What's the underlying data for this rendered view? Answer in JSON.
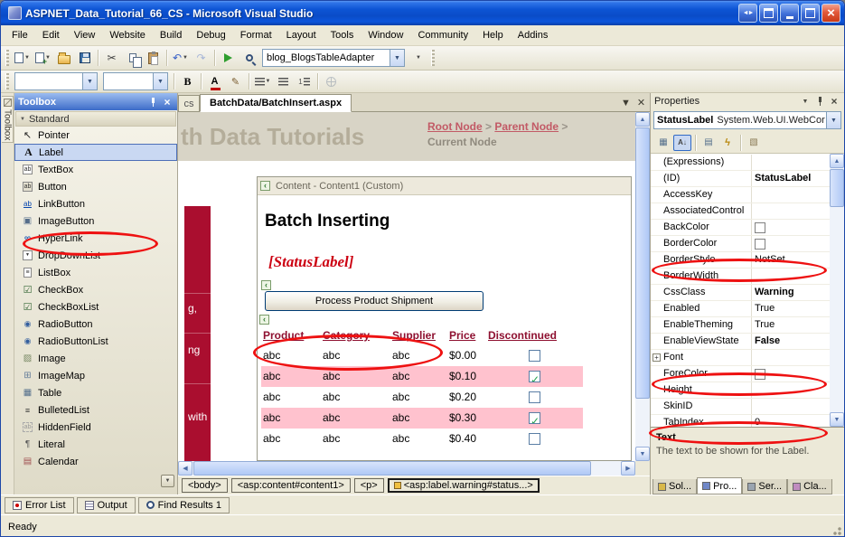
{
  "window": {
    "title": "ASPNET_Data_Tutorial_66_CS - Microsoft Visual Studio",
    "status": "Ready"
  },
  "menubar": {
    "items": [
      "File",
      "Edit",
      "View",
      "Website",
      "Build",
      "Debug",
      "Format",
      "Layout",
      "Tools",
      "Window",
      "Community",
      "Help",
      "Addins"
    ]
  },
  "toolbar": {
    "adapter_combo": "blog_BlogsTableAdapter"
  },
  "toolbox": {
    "side_tab": "Toolbox",
    "title": "Toolbox",
    "group": "Standard",
    "items": [
      {
        "label": "Pointer",
        "icon": "pointer-icon",
        "glyph": "↖"
      },
      {
        "label": "Label",
        "icon": "label-icon",
        "glyph": "A"
      },
      {
        "label": "TextBox",
        "icon": "textbox-icon",
        "glyph": "ab"
      },
      {
        "label": "Button",
        "icon": "button-icon",
        "glyph": "ab"
      },
      {
        "label": "LinkButton",
        "icon": "linkbutton-icon",
        "glyph": "ab"
      },
      {
        "label": "ImageButton",
        "icon": "imagebutton-icon",
        "glyph": "▣"
      },
      {
        "label": "HyperLink",
        "icon": "hyperlink-icon",
        "glyph": "∞"
      },
      {
        "label": "DropDownList",
        "icon": "dropdownlist-icon",
        "glyph": "▼"
      },
      {
        "label": "ListBox",
        "icon": "listbox-icon",
        "glyph": "≡"
      },
      {
        "label": "CheckBox",
        "icon": "checkbox-icon",
        "glyph": "☑"
      },
      {
        "label": "CheckBoxList",
        "icon": "checkboxlist-icon",
        "glyph": "☑"
      },
      {
        "label": "RadioButton",
        "icon": "radiobutton-icon",
        "glyph": "◉"
      },
      {
        "label": "RadioButtonList",
        "icon": "radiobuttonlist-icon",
        "glyph": "◉"
      },
      {
        "label": "Image",
        "icon": "image-icon",
        "glyph": "▨"
      },
      {
        "label": "ImageMap",
        "icon": "imagemap-icon",
        "glyph": "⊞"
      },
      {
        "label": "Table",
        "icon": "table-icon",
        "glyph": "▦"
      },
      {
        "label": "BulletedList",
        "icon": "bulletedlist-icon",
        "glyph": "≡"
      },
      {
        "label": "HiddenField",
        "icon": "hiddenfield-icon",
        "glyph": "ab"
      },
      {
        "label": "Literal",
        "icon": "literal-icon",
        "glyph": "¶"
      },
      {
        "label": "Calendar",
        "icon": "calendar-icon",
        "glyph": "▤"
      }
    ]
  },
  "editor": {
    "tabs": {
      "partial": "cs",
      "active": "BatchData/BatchInsert.aspx"
    },
    "page": {
      "banner_title": "th Data Tutorials",
      "breadcrumb": {
        "root": "Root Node",
        "sep1": ">",
        "parent": "Parent Node",
        "sep2": ">",
        "current": "Current Node"
      },
      "sidebar_fragments": [
        "g,",
        "ng",
        "with"
      ],
      "content_header": "Content - Content1 (Custom)",
      "heading": "Batch Inserting",
      "status_label": "[StatusLabel]",
      "shipment_button": "Process Product Shipment",
      "table": {
        "headers": [
          "Product",
          "Category",
          "Supplier",
          "Price",
          "Discontinued"
        ],
        "rows": [
          {
            "cells": [
              "abc",
              "abc",
              "abc",
              "$0.00"
            ],
            "discontinued": false
          },
          {
            "cells": [
              "abc",
              "abc",
              "abc",
              "$0.10"
            ],
            "discontinued": true
          },
          {
            "cells": [
              "abc",
              "abc",
              "abc",
              "$0.20"
            ],
            "discontinued": false
          },
          {
            "cells": [
              "abc",
              "abc",
              "abc",
              "$0.30"
            ],
            "discontinued": true
          },
          {
            "cells": [
              "abc",
              "abc",
              "abc",
              "$0.40"
            ],
            "discontinued": false
          }
        ]
      }
    },
    "tag_path": [
      "<body>",
      "<asp:content#content1>",
      "<p>",
      "<asp:label.warning#status...>"
    ]
  },
  "properties": {
    "title": "Properties",
    "object_name": "StatusLabel",
    "object_type": "System.Web.UI.WebCor",
    "rows": [
      {
        "name": "(Expressions)",
        "value": ""
      },
      {
        "name": "(ID)",
        "value": "StatusLabel"
      },
      {
        "name": "AccessKey",
        "value": ""
      },
      {
        "name": "AssociatedControl",
        "value": ""
      },
      {
        "name": "BackColor",
        "value": ""
      },
      {
        "name": "BorderColor",
        "value": ""
      },
      {
        "name": "BorderStyle",
        "value": "NotSet"
      },
      {
        "name": "BorderWidth",
        "value": ""
      },
      {
        "name": "CssClass",
        "value": "Warning"
      },
      {
        "name": "Enabled",
        "value": "True"
      },
      {
        "name": "EnableTheming",
        "value": "True"
      },
      {
        "name": "EnableViewState",
        "value": "False"
      },
      {
        "name": "Font",
        "value": ""
      },
      {
        "name": "ForeColor",
        "value": ""
      },
      {
        "name": "Height",
        "value": ""
      },
      {
        "name": "SkinID",
        "value": ""
      },
      {
        "name": "TabIndex",
        "value": "0"
      }
    ],
    "description_title": "Text",
    "description_body": "The text to be shown for the Label.",
    "tabs": [
      "Sol...",
      "Pro...",
      "Ser...",
      "Cla..."
    ]
  },
  "bottom": {
    "tabs": [
      "Error List",
      "Output",
      "Find Results 1"
    ]
  },
  "colors": {
    "accent_maroon": "#AA0E2F",
    "pink_row": "#FFC2CE",
    "annotation_red": "#EE1111",
    "selection_blue": "#316AC5",
    "titlebar_blue": "#0D54D4"
  }
}
